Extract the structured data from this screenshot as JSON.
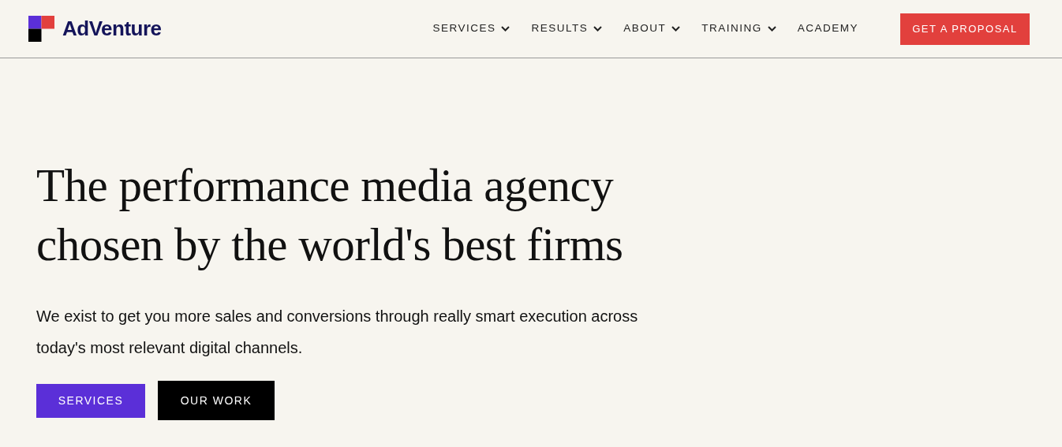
{
  "logo": {
    "text": "AdVenture"
  },
  "nav": [
    {
      "label": "SERVICES",
      "has_menu": true
    },
    {
      "label": "RESULTS",
      "has_menu": true
    },
    {
      "label": "ABOUT",
      "has_menu": true
    },
    {
      "label": "TRAINING",
      "has_menu": true
    },
    {
      "label": "ACADEMY",
      "has_menu": false
    }
  ],
  "cta": {
    "label": "GET A PROPOSAL"
  },
  "hero": {
    "headline": [
      "The performance media agency",
      "chosen by the world's best firms"
    ],
    "text": "We exist to get you more sales and conversions through really smart execution across today's most relevant digital channels.",
    "buttons": [
      {
        "label": "SERVICES",
        "kind": "primary"
      },
      {
        "label": "OUR WORK",
        "kind": "dark"
      }
    ]
  }
}
